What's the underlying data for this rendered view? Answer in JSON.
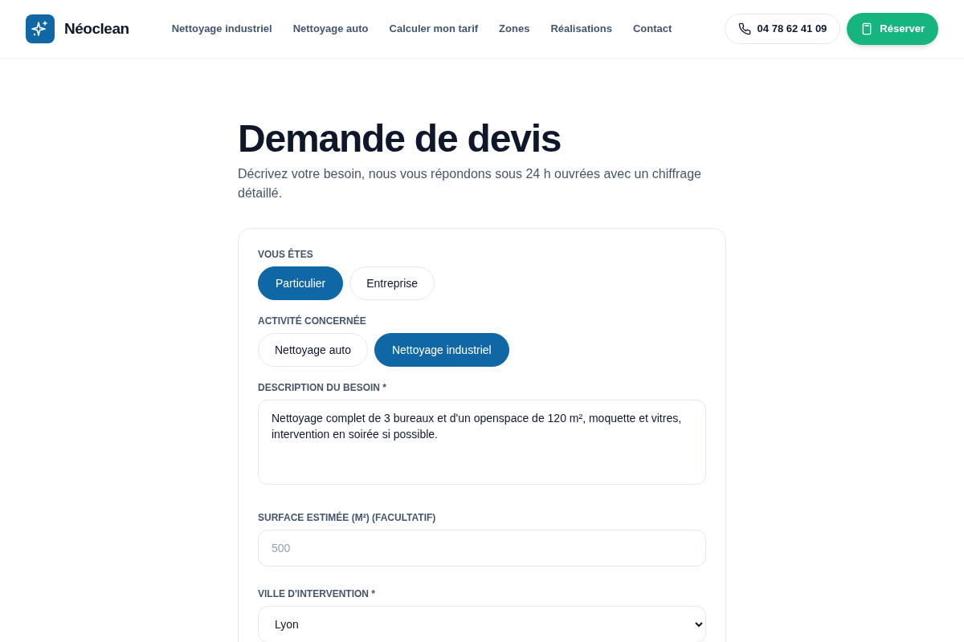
{
  "header": {
    "brand": "Néoclean",
    "nav": [
      "Nettoyage industriel",
      "Nettoyage auto",
      "Calculer mon tarif",
      "Zones",
      "Réalisations",
      "Contact"
    ],
    "phone": "04 78 62 41 09",
    "cta": "Réserver"
  },
  "page": {
    "title": "Demande de devis",
    "intro": "Décrivez votre besoin, nous vous répondons sous 24 h ouvrées avec un chiffrage détaillé."
  },
  "form": {
    "groups": [
      {
        "kind": "choice",
        "label": "VOUS ÊTES",
        "options": [
          {
            "label": "Particulier",
            "selected": true
          },
          {
            "label": "Entreprise",
            "selected": false
          }
        ]
      },
      {
        "kind": "choice",
        "label": "ACTIVITÉ CONCERNÉE",
        "options": [
          {
            "label": "Nettoyage auto",
            "selected": false
          },
          {
            "label": "Nettoyage industriel",
            "selected": true
          }
        ]
      },
      {
        "kind": "textarea",
        "label": "DESCRIPTION DU BESOIN *",
        "value": "Nettoyage complet de 3 bureaux et d'un openspace de 120 m², moquette et vitres, intervention en soirée si possible."
      },
      {
        "kind": "input",
        "label": "SURFACE ESTIMÉE (M²) (FACULTATIF)",
        "placeholder": "500"
      },
      {
        "kind": "select",
        "label": "VILLE D'INTERVENTION *",
        "value": "Lyon"
      }
    ]
  }
}
